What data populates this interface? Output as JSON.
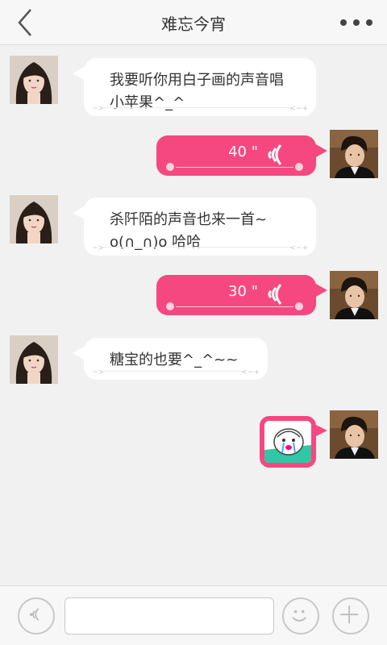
{
  "header": {
    "title": "难忘今宵",
    "back_icon": "chevron-left-icon",
    "more_icon": "more-dots-icon"
  },
  "messages": [
    {
      "side": "left",
      "type": "text",
      "line1": "我要听你用白子画的声音唱",
      "line2": "小苹果^_^"
    },
    {
      "side": "right",
      "type": "voice",
      "duration": "40 \""
    },
    {
      "side": "left",
      "type": "text",
      "line1": "杀阡陌的声音也来一首~",
      "line2": "o(∩_∩)o 哈哈"
    },
    {
      "side": "right",
      "type": "voice",
      "duration": "30 \""
    },
    {
      "side": "left",
      "type": "text",
      "line1": "糖宝的也要^_^~~",
      "line2": ""
    },
    {
      "side": "right",
      "type": "sticker"
    }
  ],
  "bubble_deco": {
    "left": "~>",
    "right": "<~+"
  },
  "composer": {
    "input_value": "",
    "voice_icon": "voice-wave-icon",
    "emoji_icon": "smiley-icon",
    "plus_icon": "plus-icon"
  },
  "colors": {
    "accent": "#f54780",
    "background": "#f1f1f1",
    "bubble": "#ffffff"
  }
}
